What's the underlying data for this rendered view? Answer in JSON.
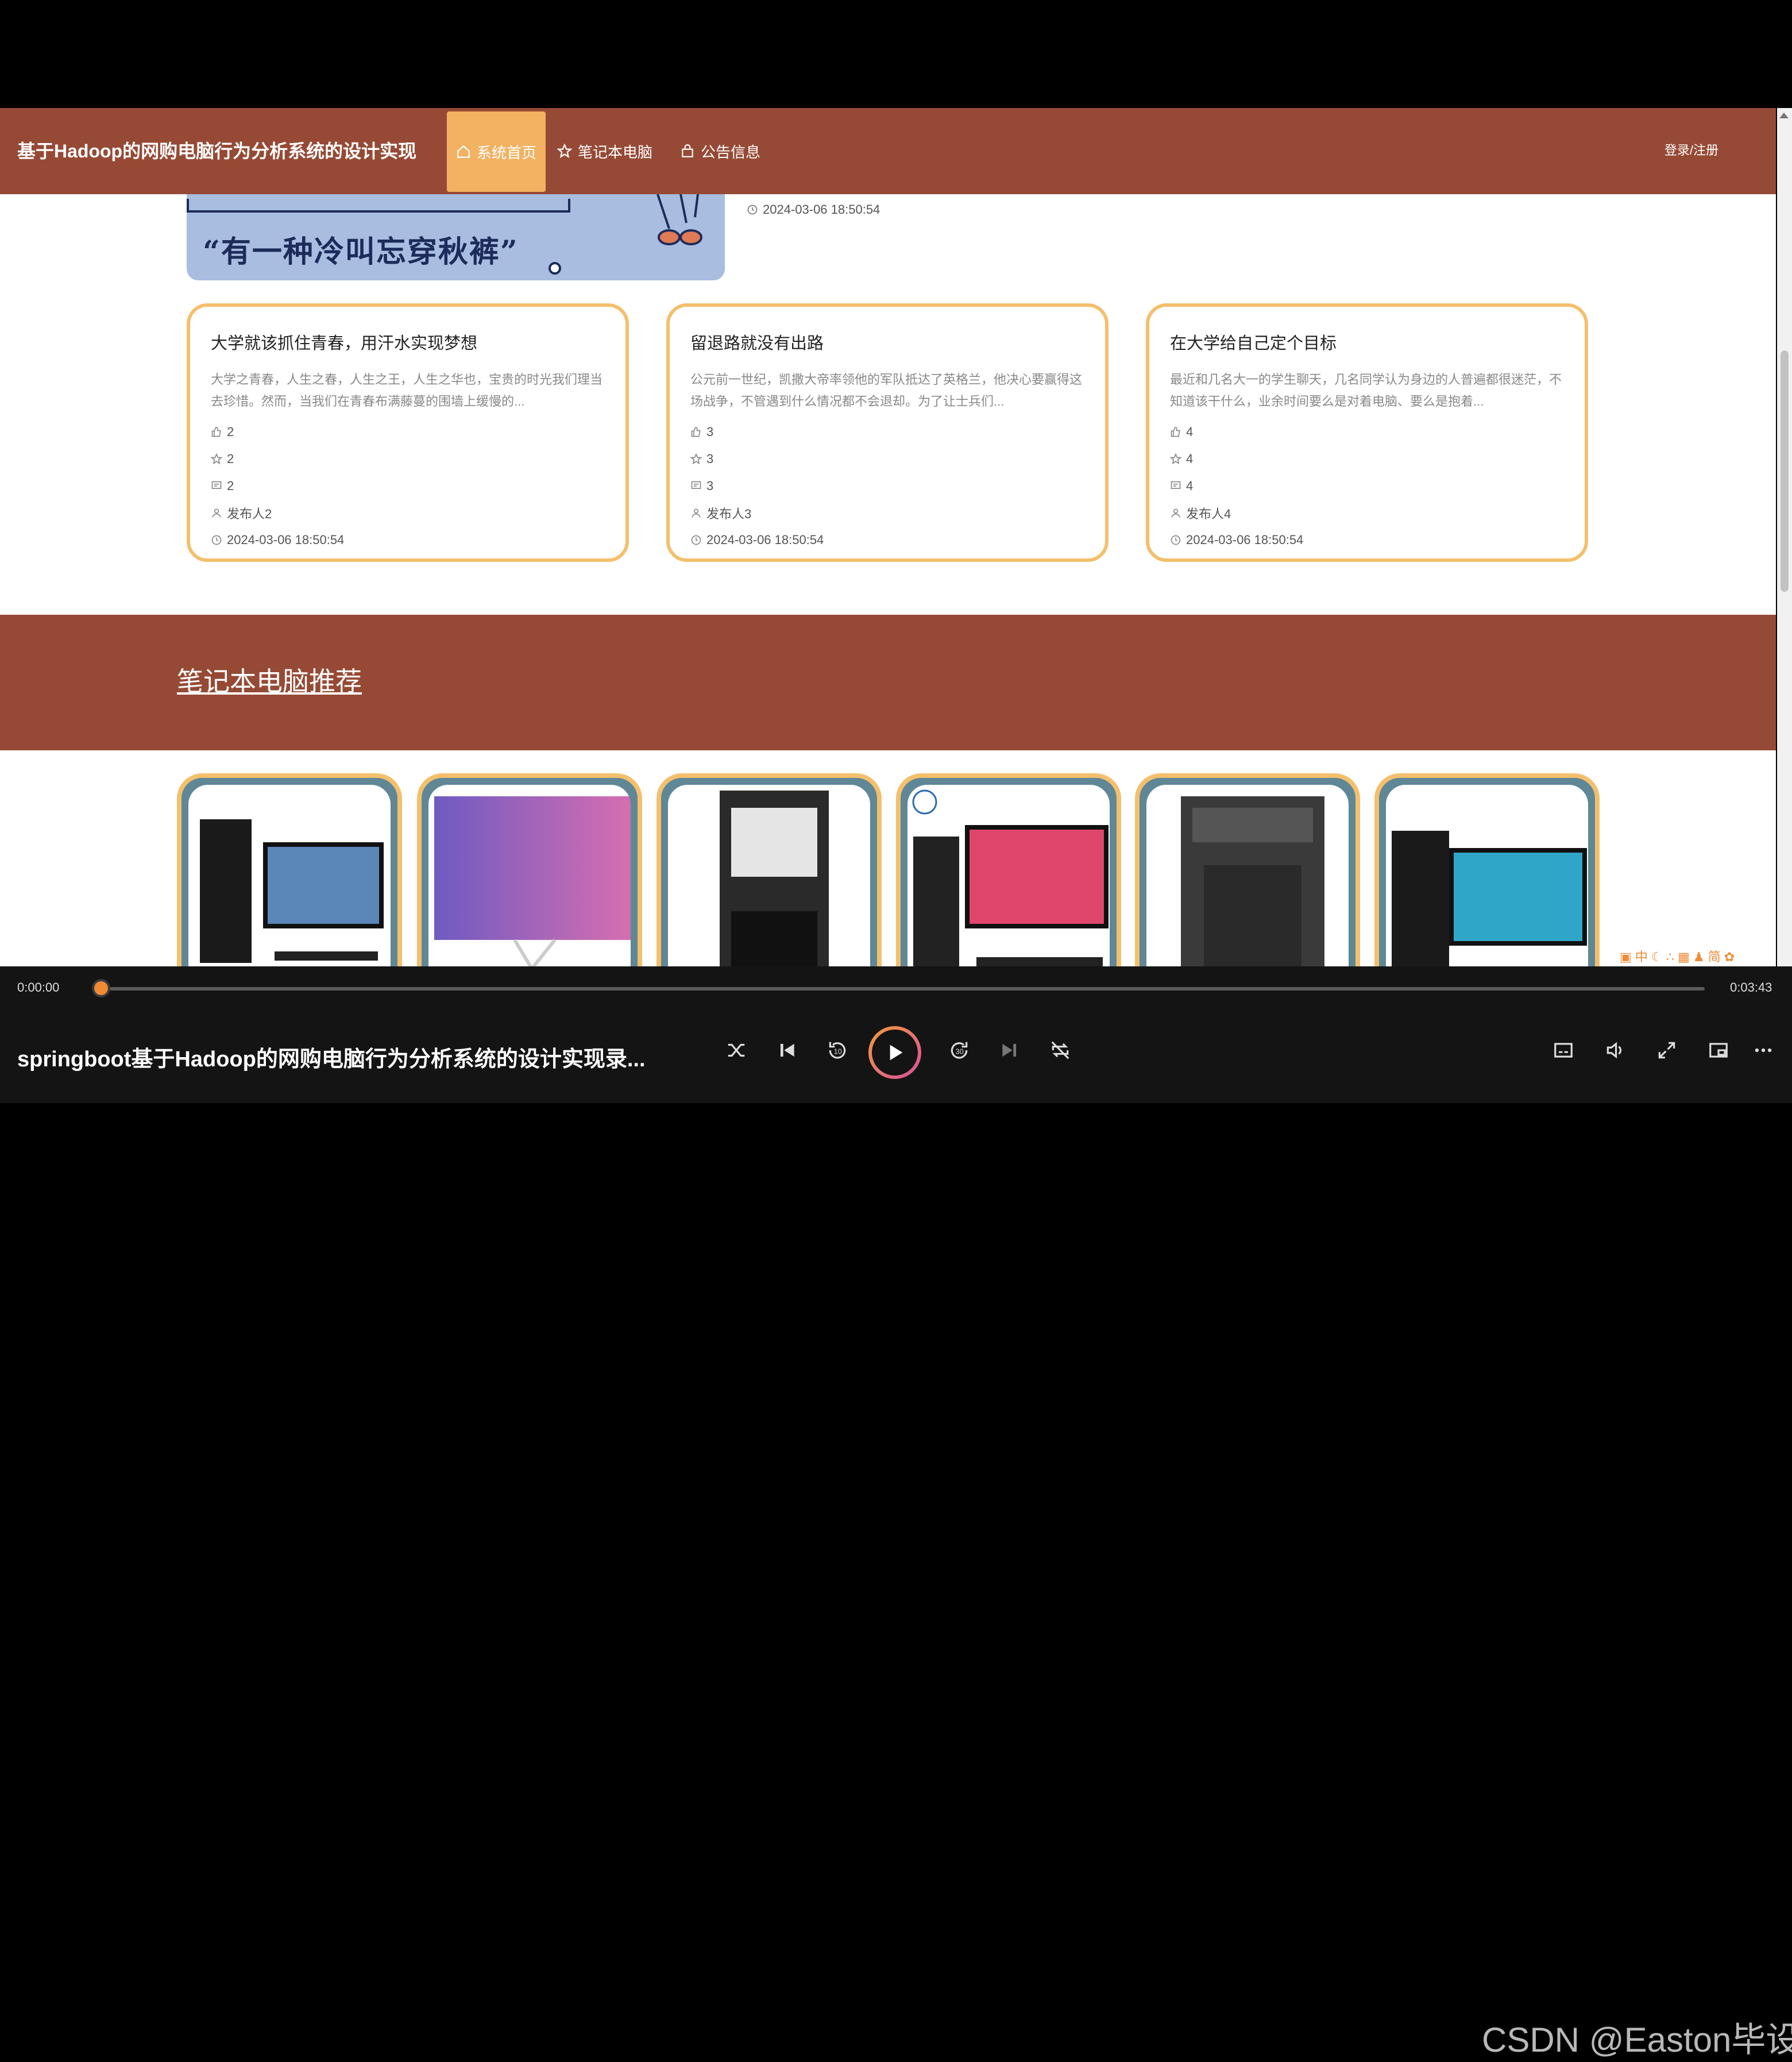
{
  "header": {
    "brand": "基于Hadoop的网购电脑行为分析系统的设计实现",
    "nav": [
      {
        "label": "系统首页",
        "icon": "home-icon",
        "active": true
      },
      {
        "label": "笔记本电脑",
        "icon": "star-icon",
        "active": false
      },
      {
        "label": "公告信息",
        "icon": "bag-icon",
        "active": false
      }
    ],
    "login": "登录/注册"
  },
  "banner": {
    "caption": "“有一种冷叫忘穿秋裤”",
    "time": "2024-03-06 18:50:54"
  },
  "cards": [
    {
      "title": "大学就该抓住青春，用汗水实现梦想",
      "body": "大学之青春，人生之春，人生之王，人生之华也，宝贵的时光我们理当去珍惜。然而，当我们在青春布满藤蔓的围墙上缓慢的...",
      "likes": "2",
      "favorites": "2",
      "comments": "2",
      "author": "发布人2",
      "time": "2024-03-06 18:50:54"
    },
    {
      "title": "留退路就没有出路",
      "body": "公元前一世纪，凯撒大帝率领他的军队抵达了英格兰，他决心要赢得这场战争，不管遇到什么情况都不会退却。为了让士兵们...",
      "likes": "3",
      "favorites": "3",
      "comments": "3",
      "author": "发布人3",
      "time": "2024-03-06 18:50:54"
    },
    {
      "title": "在大学给自己定个目标",
      "body": "最近和几名大一的学生聊天，几名同学认为身边的人普遍都很迷茫，不知道该干什么，业余时间要么是对着电脑、要么是抱着...",
      "likes": "4",
      "favorites": "4",
      "comments": "4",
      "author": "发布人4",
      "time": "2024-03-06 18:50:54"
    }
  ],
  "section": {
    "title": "笔记本电脑推荐"
  },
  "products": [
    {
      "image": "desktop-pc-with-monitor"
    },
    {
      "image": "monitor-with-game-art"
    },
    {
      "image": "tower-pc"
    },
    {
      "image": "dell-pc-with-monitor"
    },
    {
      "image": "gaming-tower"
    },
    {
      "image": "dell-tower-with-monitor"
    }
  ],
  "player": {
    "current": "0:00:00",
    "duration": "0:03:43",
    "progress": 0.0,
    "title": "springboot基于Hadoop的网购电脑行为分析系统的设计实现录...",
    "watermark": "CSDN @Easton毕设"
  },
  "colors": {
    "nav": "#964a35",
    "accent": "#f2b261",
    "cardBorder": "#f4bf6c",
    "progress": "#f08a35"
  }
}
